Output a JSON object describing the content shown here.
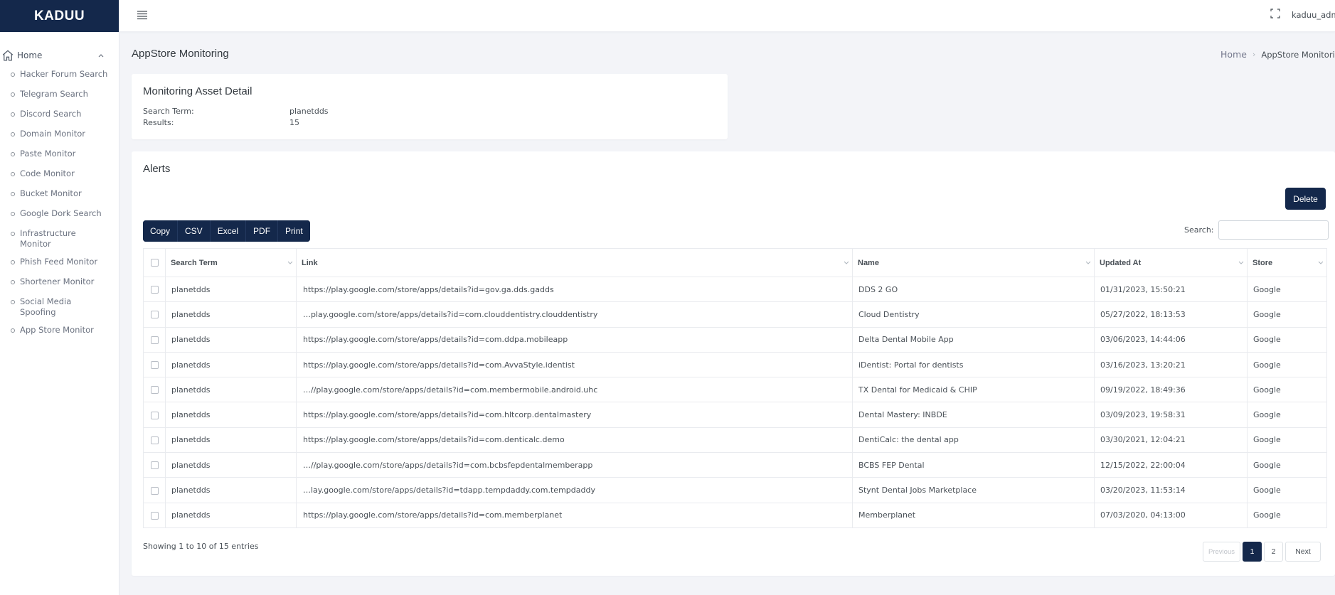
{
  "brand": "KADUU",
  "sidebar": {
    "home_label": "Home",
    "items": [
      {
        "label": "Hacker Forum Search"
      },
      {
        "label": "Telegram Search"
      },
      {
        "label": "Discord Search"
      },
      {
        "label": "Domain Monitor"
      },
      {
        "label": "Paste Monitor"
      },
      {
        "label": "Code Monitor"
      },
      {
        "label": "Bucket Monitor"
      },
      {
        "label": "Google Dork Search"
      },
      {
        "label": "Infrastructure Monitor"
      },
      {
        "label": "Phish Feed Monitor"
      },
      {
        "label": "Shortener Monitor"
      },
      {
        "label": "Social Media Spoofing"
      },
      {
        "label": "App Store Monitor"
      }
    ]
  },
  "topbar": {
    "username": "kaduu_admin"
  },
  "page": {
    "title": "AppStore Monitoring",
    "breadcrumb_home": "Home",
    "breadcrumb_current": "AppStore Monitoring"
  },
  "asset": {
    "title": "Monitoring Asset Detail",
    "search_term_label": "Search Term:",
    "search_term_value": "planetdds",
    "results_label": "Results:",
    "results_value": "15"
  },
  "alerts": {
    "title": "Alerts",
    "delete_label": "Delete",
    "export_buttons": [
      "Copy",
      "CSV",
      "Excel",
      "PDF",
      "Print"
    ],
    "search_label": "Search:",
    "search_value": "",
    "columns": [
      "Search Term",
      "Link",
      "Name",
      "Updated At",
      "Store"
    ],
    "rows": [
      {
        "term": "planetdds",
        "link": "https://play.google.com/store/apps/details?id=gov.ga.dds.gadds",
        "name": "DDS 2 GO",
        "updated": "01/31/2023, 15:50:21",
        "store": "Google"
      },
      {
        "term": "planetdds",
        "link": "…play.google.com/store/apps/details?id=com.clouddentistry.clouddentistry",
        "name": "Cloud Dentistry",
        "updated": "05/27/2022, 18:13:53",
        "store": "Google"
      },
      {
        "term": "planetdds",
        "link": "https://play.google.com/store/apps/details?id=com.ddpa.mobileapp",
        "name": "Delta Dental Mobile App",
        "updated": "03/06/2023, 14:44:06",
        "store": "Google"
      },
      {
        "term": "planetdds",
        "link": "https://play.google.com/store/apps/details?id=com.AvvaStyle.identist",
        "name": "iDentist: Portal for dentists",
        "updated": "03/16/2023, 13:20:21",
        "store": "Google"
      },
      {
        "term": "planetdds",
        "link": "…//play.google.com/store/apps/details?id=com.membermobile.android.uhc",
        "name": "TX Dental for Medicaid & CHIP",
        "updated": "09/19/2022, 18:49:36",
        "store": "Google"
      },
      {
        "term": "planetdds",
        "link": "https://play.google.com/store/apps/details?id=com.hltcorp.dentalmastery",
        "name": "Dental Mastery: INBDE",
        "updated": "03/09/2023, 19:58:31",
        "store": "Google"
      },
      {
        "term": "planetdds",
        "link": "https://play.google.com/store/apps/details?id=com.denticalc.demo",
        "name": "DentiCalc: the dental app",
        "updated": "03/30/2021, 12:04:21",
        "store": "Google"
      },
      {
        "term": "planetdds",
        "link": "…//play.google.com/store/apps/details?id=com.bcbsfepdentalmemberapp",
        "name": "BCBS FEP Dental",
        "updated": "12/15/2022, 22:00:04",
        "store": "Google"
      },
      {
        "term": "planetdds",
        "link": "…lay.google.com/store/apps/details?id=tdapp.tempdaddy.com.tempdaddy",
        "name": "Stynt Dental Jobs Marketplace",
        "updated": "03/20/2023, 11:53:14",
        "store": "Google"
      },
      {
        "term": "planetdds",
        "link": "https://play.google.com/store/apps/details?id=com.memberplanet",
        "name": "Memberplanet",
        "updated": "07/03/2020, 04:13:00",
        "store": "Google"
      }
    ],
    "info": "Showing 1 to 10 of 15 entries",
    "pager": {
      "previous": "Previous",
      "pages": [
        "1",
        "2"
      ],
      "next": "Next"
    }
  },
  "colors": {
    "accent": "#14284b"
  }
}
